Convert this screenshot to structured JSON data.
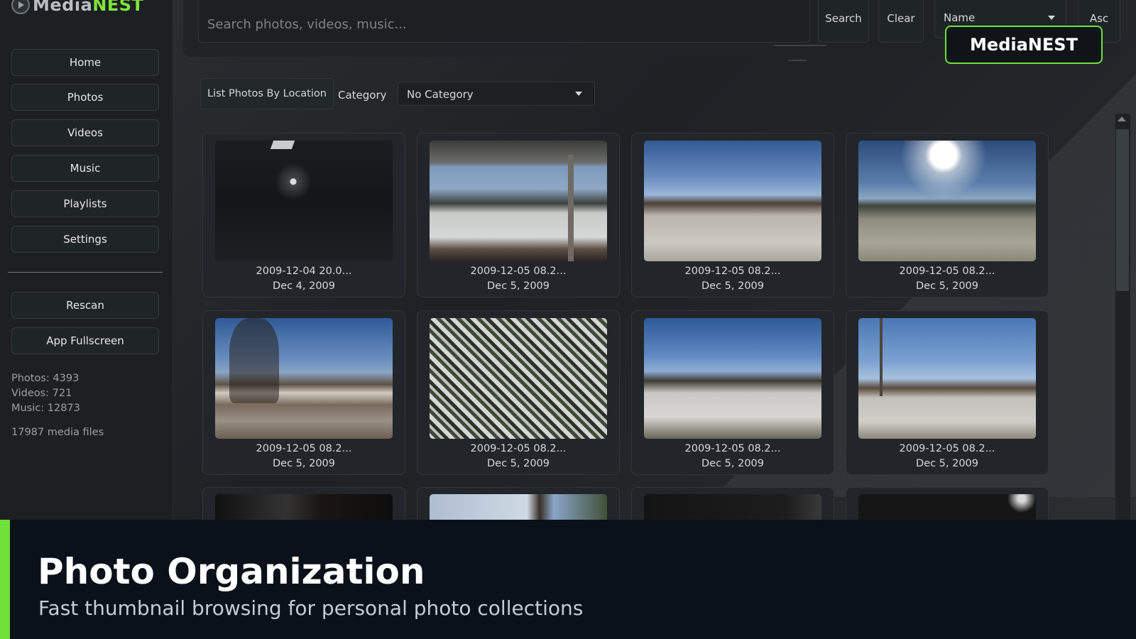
{
  "app": {
    "logo_prefix": "Media",
    "logo_accent": "NEST",
    "brand_badge": "MediaNEST"
  },
  "sidebar": {
    "items": [
      {
        "label": "Home"
      },
      {
        "label": "Photos"
      },
      {
        "label": "Videos"
      },
      {
        "label": "Music"
      },
      {
        "label": "Playlists"
      },
      {
        "label": "Settings"
      }
    ],
    "actions": [
      {
        "label": "Rescan"
      },
      {
        "label": "App Fullscreen"
      }
    ],
    "stats": {
      "photos": "Photos: 4393",
      "videos": "Videos: 721",
      "music": "Music: 12873",
      "total": "17987 media files"
    }
  },
  "search": {
    "placeholder": "Search photos, videos, music...",
    "search_label": "Search",
    "clear_label": "Clear",
    "sort_field": "Name",
    "sort_order": "Asc"
  },
  "filters": {
    "list_by_location_label": "List Photos By Location",
    "category_label": "Category",
    "category_value": "No Category"
  },
  "photos": [
    {
      "title": "2009-12-04 20.0...",
      "date": "Dec 4, 2009"
    },
    {
      "title": "2009-12-05 08.2...",
      "date": "Dec 5, 2009"
    },
    {
      "title": "2009-12-05 08.2...",
      "date": "Dec 5, 2009"
    },
    {
      "title": "2009-12-05 08.2...",
      "date": "Dec 5, 2009"
    },
    {
      "title": "2009-12-05 08.2...",
      "date": "Dec 5, 2009"
    },
    {
      "title": "2009-12-05 08.2...",
      "date": "Dec 5, 2009"
    },
    {
      "title": "2009-12-05 08.2...",
      "date": "Dec 5, 2009"
    },
    {
      "title": "2009-12-05 08.2...",
      "date": "Dec 5, 2009"
    }
  ],
  "caption": {
    "title": "Photo Organization",
    "subtitle": "Fast thumbnail browsing for personal photo collections"
  },
  "colors": {
    "accent": "#6fe13a",
    "banner_bg": "#0a111a"
  }
}
